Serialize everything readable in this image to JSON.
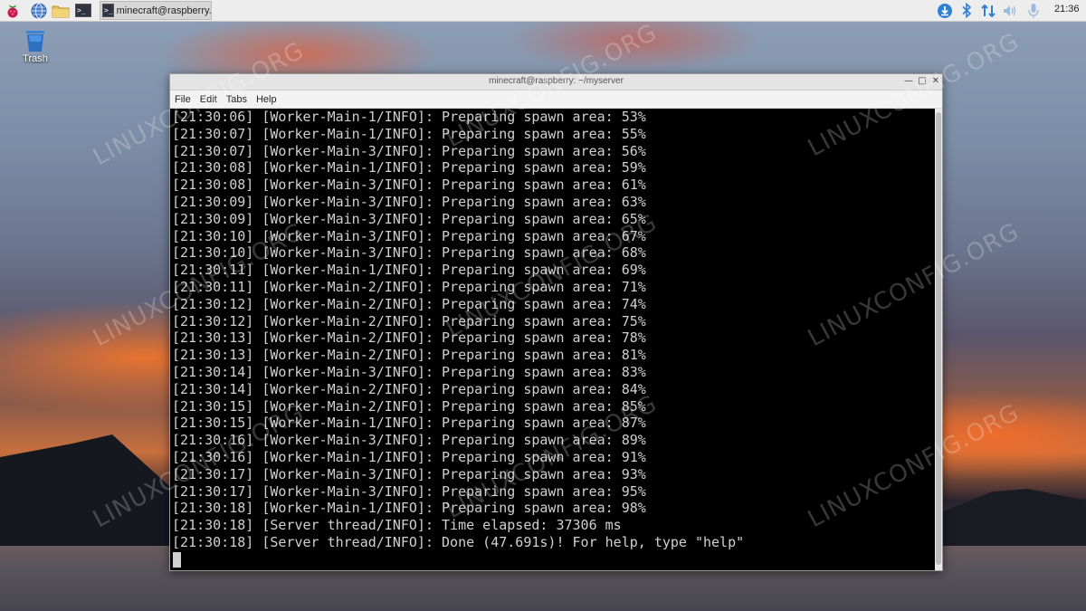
{
  "taskbar": {
    "window_title": "minecraft@raspberry...",
    "clock": "21:36",
    "launcher_icons": [
      "raspberry-menu-icon",
      "web-browser-icon",
      "file-manager-icon",
      "terminal-icon"
    ],
    "tray_icons": [
      "update-icon",
      "bluetooth-icon",
      "network-icon",
      "volume-icon",
      "microphone-icon"
    ]
  },
  "desktop": {
    "trash_label": "Trash"
  },
  "window": {
    "title": "minecraft@raspberry: ~/myserver",
    "menu": [
      "File",
      "Edit",
      "Tabs",
      "Help"
    ],
    "lines": [
      "[21:30:06] [Worker-Main-1/INFO]: Preparing spawn area: 53%",
      "[21:30:07] [Worker-Main-1/INFO]: Preparing spawn area: 55%",
      "[21:30:07] [Worker-Main-3/INFO]: Preparing spawn area: 56%",
      "[21:30:08] [Worker-Main-1/INFO]: Preparing spawn area: 59%",
      "[21:30:08] [Worker-Main-3/INFO]: Preparing spawn area: 61%",
      "[21:30:09] [Worker-Main-3/INFO]: Preparing spawn area: 63%",
      "[21:30:09] [Worker-Main-3/INFO]: Preparing spawn area: 65%",
      "[21:30:10] [Worker-Main-3/INFO]: Preparing spawn area: 67%",
      "[21:30:10] [Worker-Main-3/INFO]: Preparing spawn area: 68%",
      "[21:30:11] [Worker-Main-1/INFO]: Preparing spawn area: 69%",
      "[21:30:11] [Worker-Main-2/INFO]: Preparing spawn area: 71%",
      "[21:30:12] [Worker-Main-2/INFO]: Preparing spawn area: 74%",
      "[21:30:12] [Worker-Main-2/INFO]: Preparing spawn area: 75%",
      "[21:30:13] [Worker-Main-2/INFO]: Preparing spawn area: 78%",
      "[21:30:13] [Worker-Main-2/INFO]: Preparing spawn area: 81%",
      "[21:30:14] [Worker-Main-3/INFO]: Preparing spawn area: 83%",
      "[21:30:14] [Worker-Main-2/INFO]: Preparing spawn area: 84%",
      "[21:30:15] [Worker-Main-2/INFO]: Preparing spawn area: 85%",
      "[21:30:15] [Worker-Main-1/INFO]: Preparing spawn area: 87%",
      "[21:30:16] [Worker-Main-3/INFO]: Preparing spawn area: 89%",
      "[21:30:16] [Worker-Main-1/INFO]: Preparing spawn area: 91%",
      "[21:30:17] [Worker-Main-3/INFO]: Preparing spawn area: 93%",
      "[21:30:17] [Worker-Main-3/INFO]: Preparing spawn area: 95%",
      "[21:30:18] [Worker-Main-1/INFO]: Preparing spawn area: 98%",
      "[21:30:18] [Server thread/INFO]: Time elapsed: 37306 ms",
      "[21:30:18] [Server thread/INFO]: Done (47.691s)! For help, type \"help\""
    ]
  },
  "watermark": "LINUXCONFIG.ORG",
  "colors": {
    "terminal_bg": "#000000",
    "terminal_fg": "#d0d0d0",
    "taskbar_bg": "#ededed"
  }
}
